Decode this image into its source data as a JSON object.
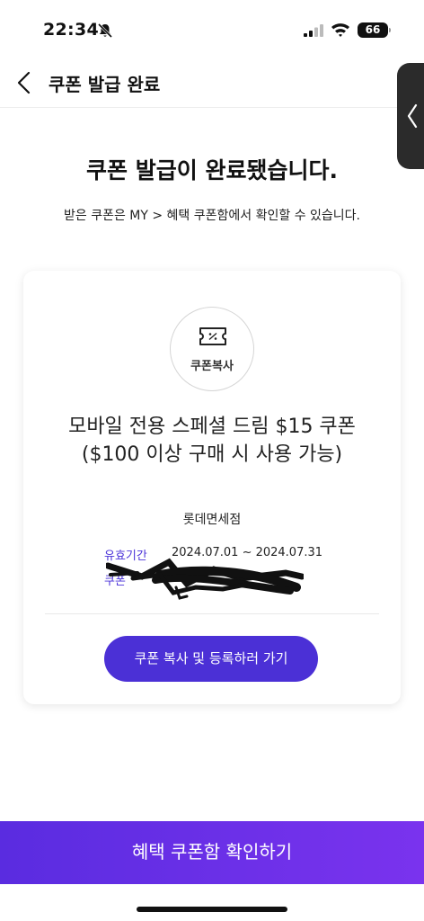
{
  "status_bar": {
    "time": "22:34",
    "battery": "66",
    "icons": [
      "bell-slash-icon",
      "signal-icon",
      "wifi-icon",
      "battery-icon"
    ]
  },
  "header": {
    "title": "쿠폰 발급 완료",
    "back_icon": "chevron-left-icon"
  },
  "side_handle": {
    "icon": "chevron-left-icon"
  },
  "message": {
    "title": "쿠폰 발급이 완료됐습니다.",
    "description": "받은 쿠폰은 MY > 혜택 쿠폰함에서 확인할 수 있습니다."
  },
  "coupon": {
    "icon": "coupon-ticket-icon",
    "badge_label": "쿠폰복사",
    "name": "모바일 전용 스페셜 드림 $15 쿠폰($100 이상 구매 시 사용 가능)",
    "brand": "롯데면세점",
    "validity_label": "유효기간",
    "validity_value": "2024.07.01 ~ 2024.07.31",
    "code_label": "쿠폰",
    "copy_button": "쿠폰 복사 및 등록하러 가기"
  },
  "bottom_button": {
    "label": "혜택 쿠폰함 확인하기"
  },
  "colors": {
    "accent": "#4b30d6",
    "gradient_start": "#5a2ce0",
    "gradient_end": "#7a33ee",
    "label_blue": "#4b33d9"
  }
}
